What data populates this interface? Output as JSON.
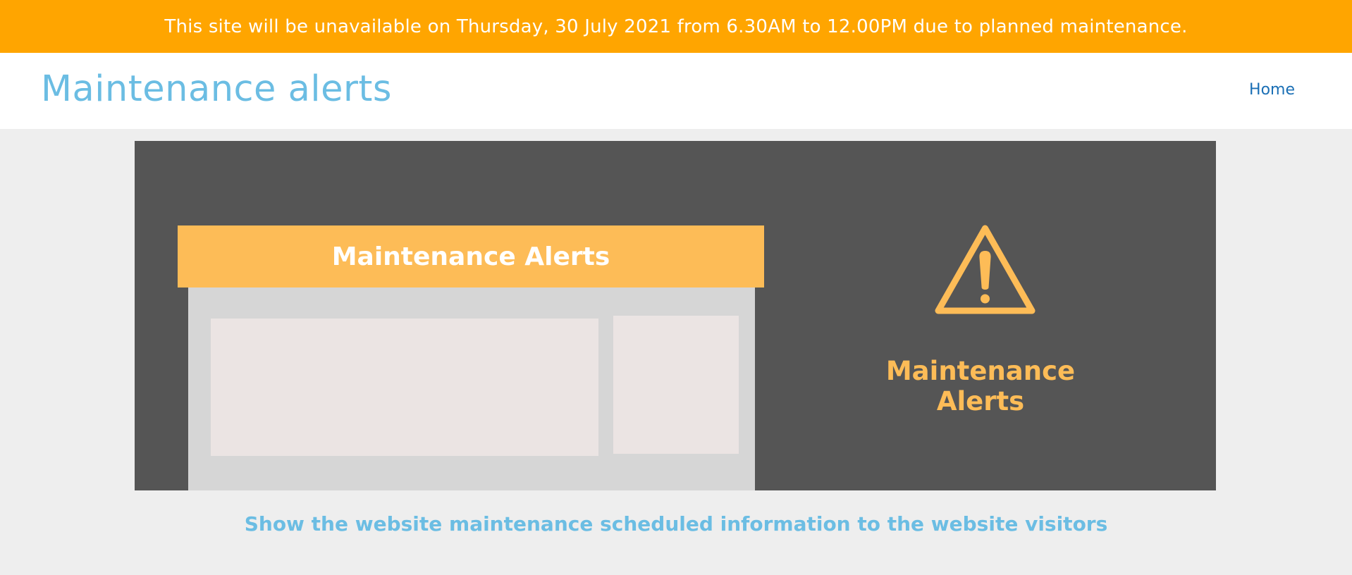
{
  "alert": {
    "message": "This site will be unavailable on Thursday, 30 July 2021 from 6.30AM to 12.00PM due to planned maintenance."
  },
  "header": {
    "title": "Maintenance alerts",
    "nav": {
      "home_label": "Home"
    }
  },
  "banner": {
    "mock_header_text": "Maintenance Alerts",
    "icon": "warning-triangle-icon",
    "label": "Maintenance Alerts"
  },
  "tagline": "Show the website maintenance scheduled information to the website visitors",
  "colors": {
    "alert_bar": "#ffa500",
    "title_blue": "#6bbde3",
    "link_blue": "#1a6fb5",
    "banner_dark": "#555555",
    "accent_orange": "#fdbc57"
  }
}
